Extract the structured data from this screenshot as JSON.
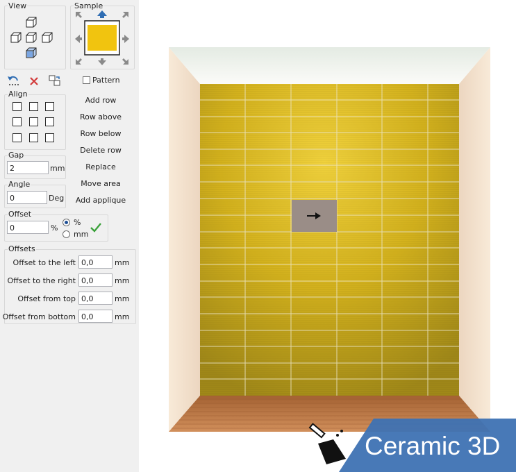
{
  "view_group": {
    "title": "View",
    "icons": [
      "cube-top-icon",
      "cube-left-icon",
      "cube-center-icon",
      "cube-right-icon",
      "cube-bottom-selected-icon"
    ]
  },
  "sample_group": {
    "title": "Sample",
    "tile_color": "#f1c40f"
  },
  "toolbar": {
    "icons": [
      "undo-icon",
      "delete-icon",
      "swap-icon"
    ]
  },
  "pattern": {
    "label": "Pattern",
    "checked": false
  },
  "align_group": {
    "title": "Align"
  },
  "actions": {
    "add_row": "Add row",
    "row_above": "Row above",
    "row_below": "Row below",
    "delete_row": "Delete row",
    "replace": "Replace",
    "move_area": "Move area",
    "add_applique": "Add applique"
  },
  "gap": {
    "title": "Gap",
    "value": "2",
    "unit": "mm"
  },
  "angle": {
    "title": "Angle",
    "value": "0",
    "unit": "Deg"
  },
  "offset": {
    "title": "Offset",
    "value": "0",
    "unit": "%",
    "radio_pct": "%",
    "radio_mm": "mm",
    "selected": "%"
  },
  "offsets": {
    "title": "Offsets",
    "rows": [
      {
        "label": "Offset to the left",
        "value": "0,0",
        "unit": "mm"
      },
      {
        "label": "Offset to the right",
        "value": "0,0",
        "unit": "mm"
      },
      {
        "label": "Offset from top",
        "value": "0,0",
        "unit": "mm"
      },
      {
        "label": "Offset from bottom",
        "value": "0,0",
        "unit": "mm"
      }
    ]
  },
  "scene": {
    "wall_color": "#d4b21d",
    "floor_color": "#b8754a",
    "selected_tile_color": "#9a8d87"
  },
  "logo": {
    "text": "Ceramic 3D",
    "bg": "#3e72b3"
  }
}
